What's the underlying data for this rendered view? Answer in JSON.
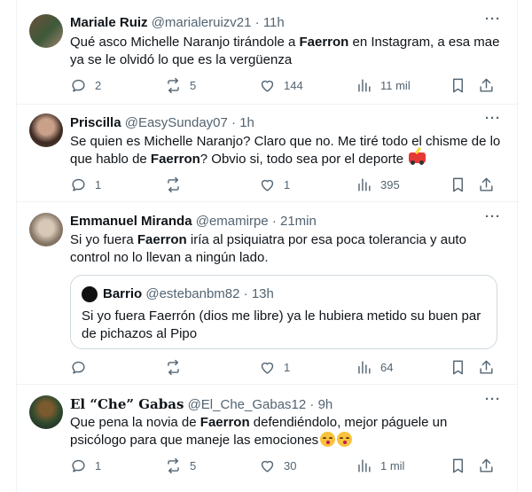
{
  "tweets": [
    {
      "name": "Mariale Ruiz",
      "handle": "@marialeruizv21",
      "dot": "·",
      "time": "11h",
      "text_parts": [
        "Qué asco Michelle Naranjo tirándole a ",
        "Faerron",
        " en Instagram, a esa mae ya se le olvidó lo que es la vergüenza"
      ],
      "replies": "2",
      "retweets": "5",
      "likes": "144",
      "views": "11 mil",
      "avatar_colors": [
        "#6b4f3a",
        "#3d5a3a",
        "#a0826d"
      ]
    },
    {
      "name": "Priscilla",
      "handle": "@EasySunday07",
      "dot": "·",
      "time": "1h",
      "text_parts": [
        "Se quien es Michelle Naranjo? Claro que no. Me tiré todo el chisme de lo que hablo de ",
        "Faerron",
        "? Obvio si, todo sea por el deporte "
      ],
      "emoji": "race-car-emoji",
      "replies": "1",
      "retweets": "",
      "likes": "1",
      "views": "395",
      "avatar_colors": [
        "#3b2a22",
        "#c9a08a",
        "#5a3f33"
      ]
    },
    {
      "name": "Emmanuel Miranda",
      "handle": "@emamirpe",
      "dot": "·",
      "time": "21min",
      "text_parts": [
        "Si yo fuera ",
        "Faerron",
        " iría al psiquiatra por esa poca tolerancia y auto control no lo llevan a ningún lado."
      ],
      "quote": {
        "name": "Barrio",
        "handle": "@estebanbm82",
        "dot": "·",
        "time": "13h",
        "text": "Si yo fuera Faerrón (dios me libre) ya le hubiera metido su buen par de pichazos al Pipo"
      },
      "replies": "",
      "retweets": "",
      "likes": "1",
      "views": "64",
      "avatar_colors": [
        "#8a7a6a",
        "#d8c8b8",
        "#5c4c3c"
      ]
    },
    {
      "name": "El “Che” Gabas",
      "handle": "@El_Che_Gabas12",
      "dot": "·",
      "time": "9h",
      "text_parts": [
        "Que pena la novia de ",
        "Faerron",
        " defendiéndolo, mejor páguele un psicólogo para que maneje las emociones"
      ],
      "emoji": "kissing-face-emoji",
      "replies": "1",
      "retweets": "5",
      "likes": "30",
      "views": "1 mil",
      "avatar_colors": [
        "#2e4a2e",
        "#7a5a2e",
        "#1e1e1e"
      ]
    }
  ],
  "more_label": "···"
}
